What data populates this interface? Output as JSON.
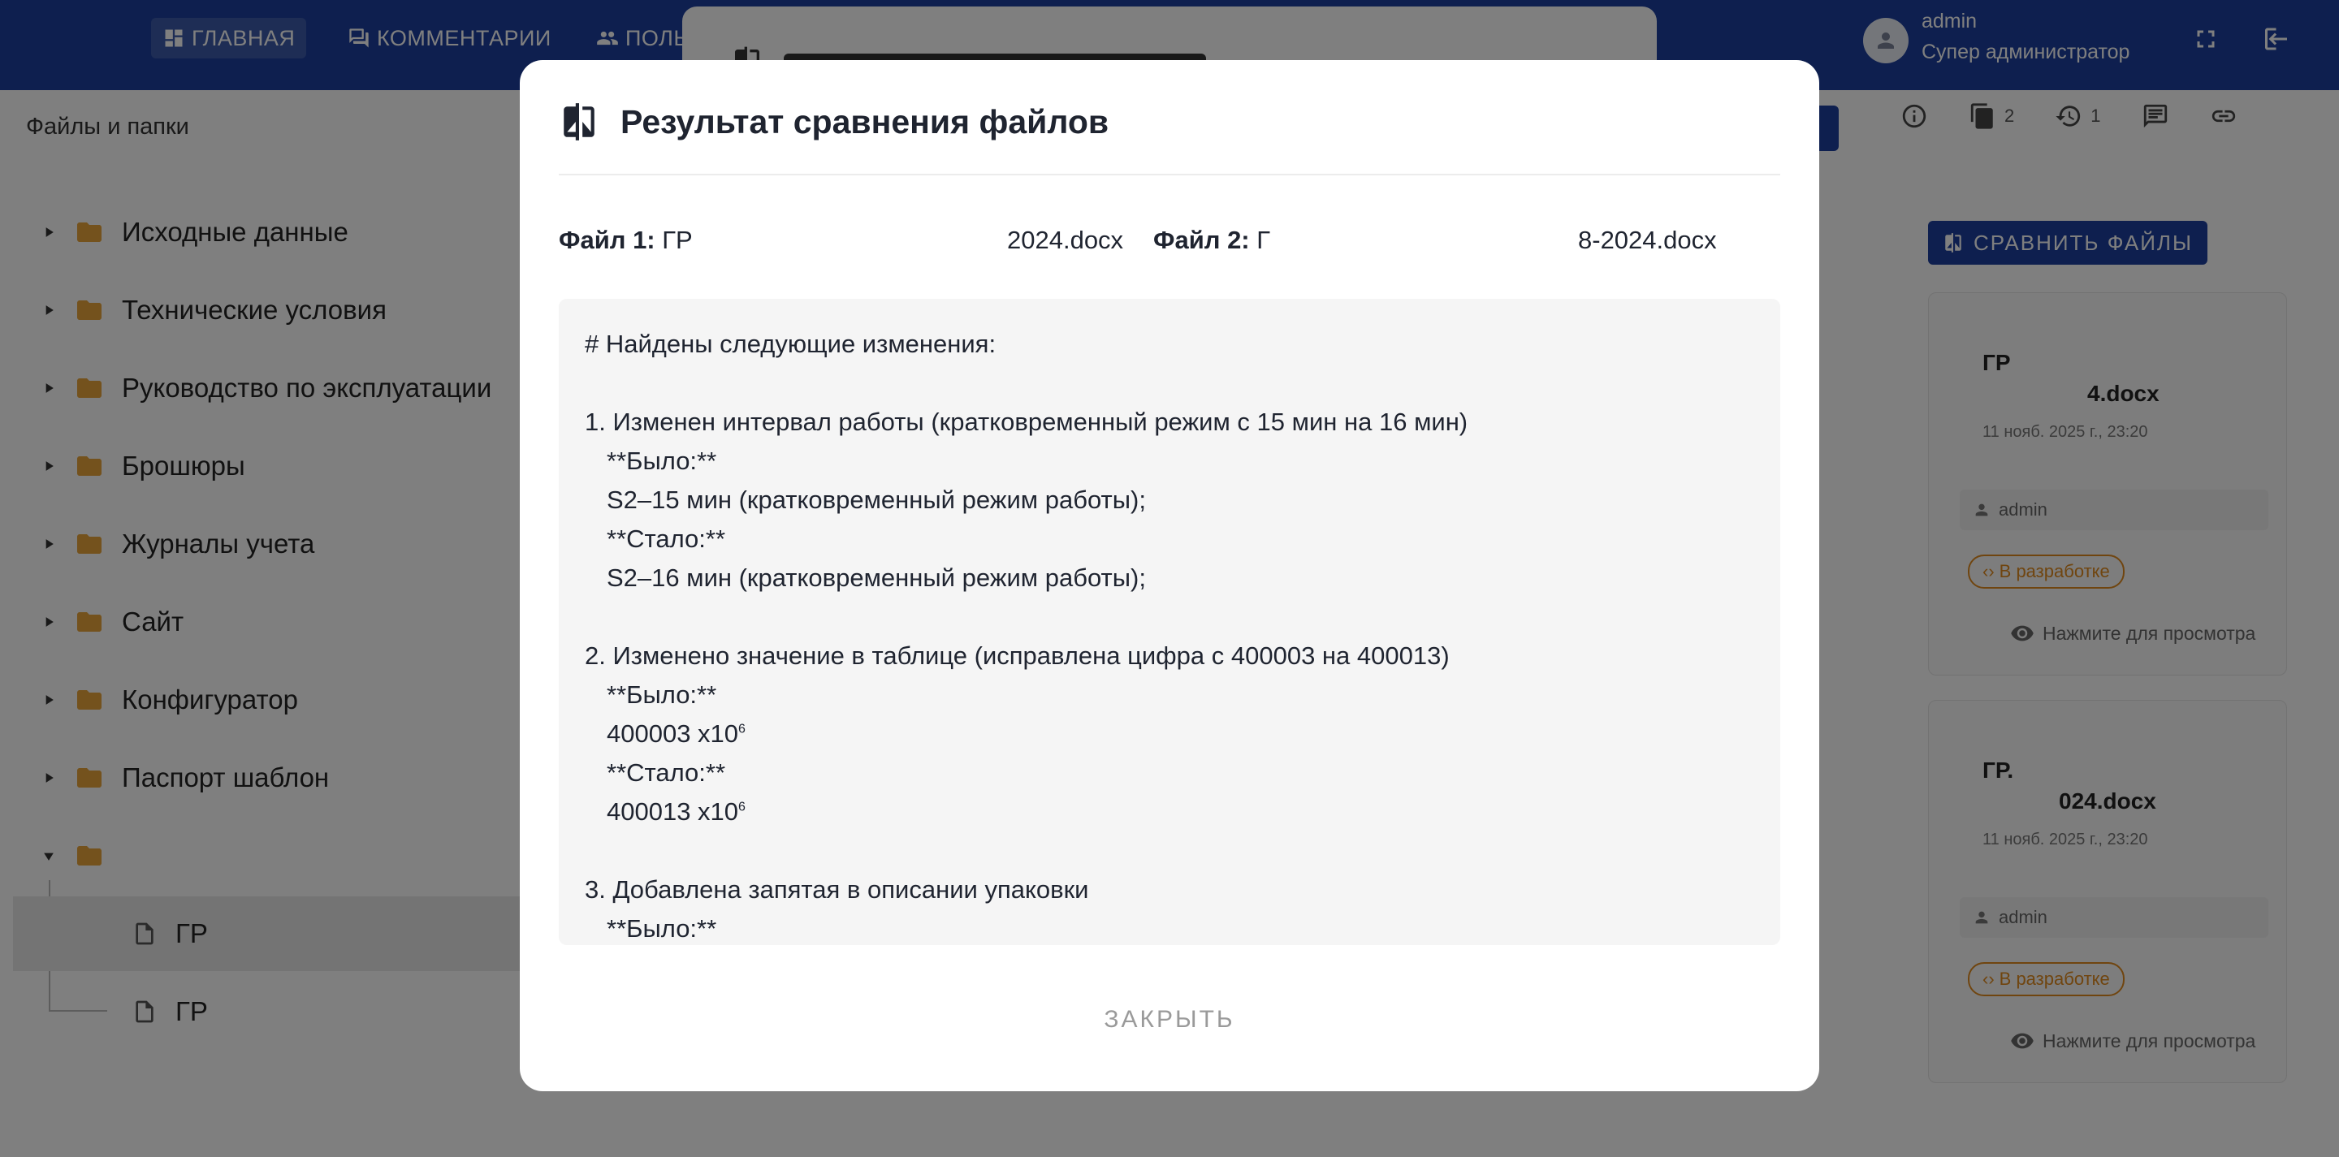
{
  "nav": {
    "items": [
      {
        "label": "ГЛАВНАЯ"
      },
      {
        "label": "КОММЕНТАРИИ"
      },
      {
        "label": "ПОЛЬ"
      }
    ],
    "user": {
      "name": "admin",
      "role": "Супер администратор"
    }
  },
  "sidebar": {
    "title": "Файлы и папки",
    "folders": [
      {
        "label": "Исходные данные"
      },
      {
        "label": "Технические условия"
      },
      {
        "label": "Руководство по эксплуатации"
      },
      {
        "label": "Брошюры"
      },
      {
        "label": "Журналы учета"
      },
      {
        "label": "Сайт"
      },
      {
        "label": "Конфигуратор"
      },
      {
        "label": "Паспорт шаблон"
      },
      {
        "label": ""
      }
    ],
    "files": [
      {
        "label": "ГР"
      },
      {
        "label": "ГР"
      }
    ]
  },
  "right_panel": {
    "files_count": "2",
    "history_count": "1",
    "compare_label": "СРАВНИТЬ ФАЙЛЫ",
    "cards": [
      {
        "title_left": "ГР",
        "title_right": "4.docx",
        "date": "11 нояб. 2025 г., 23:20",
        "user": "admin",
        "status": "В разработке",
        "view": "Нажмите для просмотра"
      },
      {
        "title_left": "ГР.",
        "title_right": "024.docx",
        "date": "11 нояб. 2025 г., 23:20",
        "user": "admin",
        "status": "В разработке",
        "view": "Нажмите для просмотра"
      }
    ]
  },
  "modal": {
    "title": "Результат сравнения файлов",
    "file1_label": "Файл 1:",
    "file1_name_start": "ГР",
    "file1_name_end": "2024.docx",
    "file2_label": "Файл 2:",
    "file2_name_start": "Г",
    "file2_name_end": "8-2024.docx",
    "lines": [
      "# Найдены следующие изменения:",
      "1. Изменен интервал работы (кратковременный режим с 15 мин на 16 мин)",
      "**Было:**",
      "S2–15 мин (кратковременный режим работы);",
      "**Стало:**",
      "S2–16 мин (кратковременный режим работы);",
      "2. Изменено значение в таблице (исправлена цифра с 400003 на 400013)",
      "**Было:**",
      "400003 x10",
      "**Стало:**",
      "400013 x10",
      "3. Добавлена запятая в описании упаковки",
      "**Было:**"
    ],
    "superscript": "6",
    "close_label": "ЗАКРЫТЬ"
  }
}
